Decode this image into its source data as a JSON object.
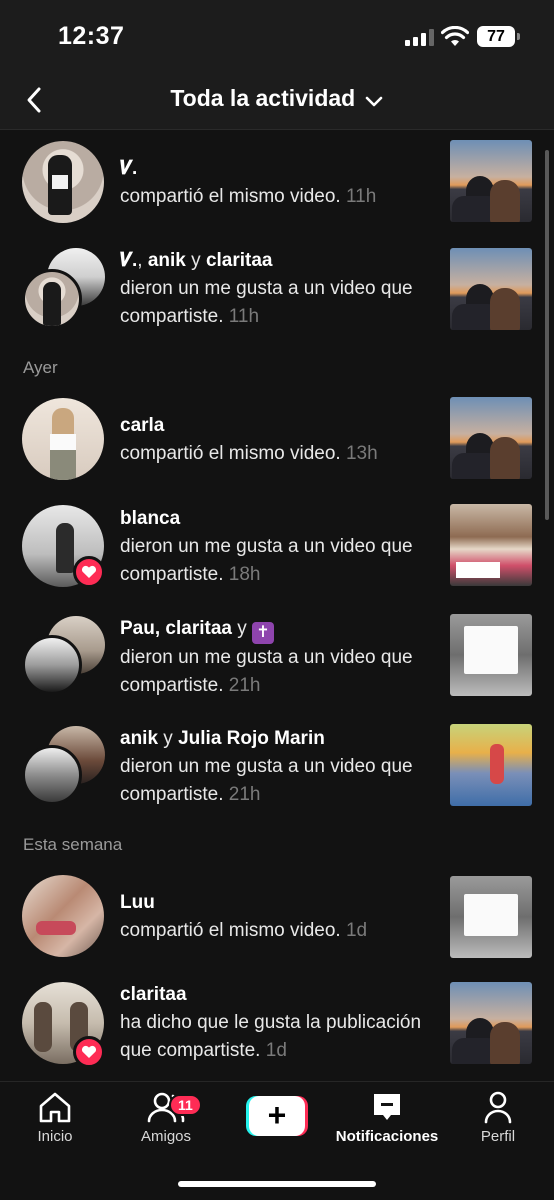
{
  "status_bar": {
    "time": "12:37",
    "battery": "77"
  },
  "header": {
    "title": "Toda la actividad"
  },
  "sections": {
    "yesterday": "Ayer",
    "this_week": "Esta semana"
  },
  "items": [
    {
      "names": "𝑽.",
      "conj1": "",
      "name2": "",
      "conj2": "",
      "name3": "",
      "action": "compartió el mismo video.",
      "time": "11h"
    },
    {
      "names": "𝑽.",
      "conj1": ", ",
      "name2": "anik",
      "conj2": " y ",
      "name3": "claritaa",
      "action": "dieron un me gusta a un video que compartiste.",
      "time": "11h"
    },
    {
      "names": "carla",
      "action": "compartió el mismo video.",
      "time": "13h"
    },
    {
      "names": "blanca",
      "action": "dieron un me gusta a un video que compartiste.",
      "time": "18h"
    },
    {
      "names": "Pau, claritaa",
      "conj": " y ",
      "emoji": "✝",
      "action": "dieron un me gusta a un video que compartiste.",
      "time": "21h"
    },
    {
      "names": "anik",
      "conj": " y ",
      "name2": "Julia Rojo Marin",
      "action": "dieron un me gusta a un video que compartiste.",
      "time": "21h"
    },
    {
      "names": "Luu",
      "action": "compartió el mismo video.",
      "time": "1d"
    },
    {
      "names": "claritaa",
      "action": "ha dicho que le gusta la publicación que compartiste.",
      "time": "1d"
    }
  ],
  "tabs": {
    "home": "Inicio",
    "friends": "Amigos",
    "friends_badge": "11",
    "notifications": "Notificaciones",
    "profile": "Perfil",
    "create_symbol": "+"
  },
  "colors": {
    "accent_pink": "#fe2c55",
    "accent_cyan": "#25f4ee",
    "background": "#121212"
  }
}
